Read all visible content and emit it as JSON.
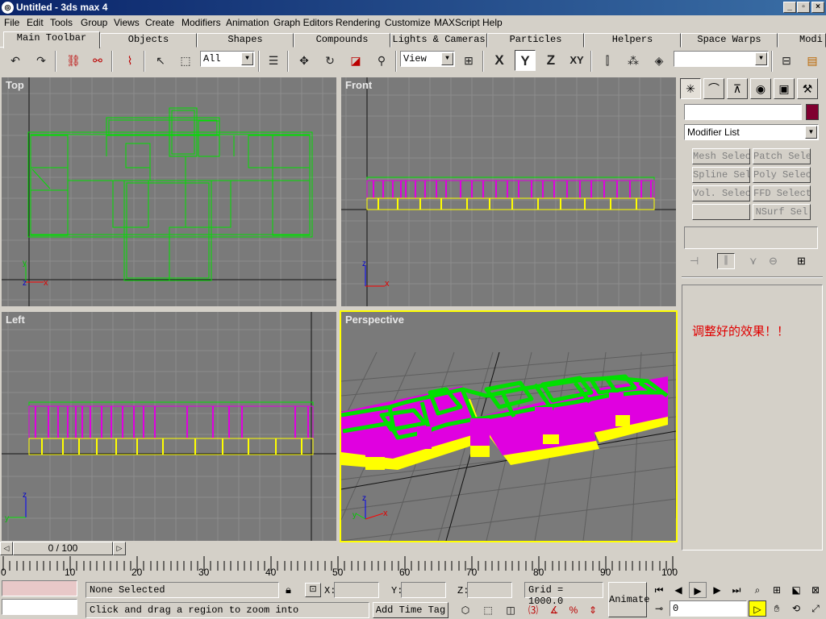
{
  "window": {
    "title": "Untitled - 3ds max 4"
  },
  "menu": [
    "File",
    "Edit",
    "Tools",
    "Group",
    "Views",
    "Create",
    "Modifiers",
    "Animation",
    "Graph Editors",
    "Rendering",
    "Customize",
    "MAXScript",
    "Help"
  ],
  "tabs": [
    "Main Toolbar",
    "Objects",
    "Shapes",
    "Compounds",
    "Lights & Cameras",
    "Particles",
    "Helpers",
    "Space Warps",
    "Modi"
  ],
  "toolbar": {
    "selection_filter": "All",
    "ref_coord": "View",
    "axis_x": "X",
    "axis_y": "Y",
    "axis_z": "Z",
    "axis_xy": "XY",
    "named_selection": ""
  },
  "viewports": {
    "top": "Top",
    "front": "Front",
    "left": "Left",
    "perspective": "Perspective"
  },
  "command_panel": {
    "object_name": "",
    "modifier_list": "Modifier List",
    "modifier_buttons": [
      "Mesh Select",
      "Patch Select",
      "Spline Select",
      "Poly Select",
      "Vol. Select",
      "FFD Select",
      "",
      "NSurf Sel"
    ],
    "note": "调整好的效果！！"
  },
  "timeslider": {
    "label": "0 / 100",
    "ticks": [
      "0",
      "10",
      "20",
      "30",
      "40",
      "50",
      "60",
      "70",
      "80",
      "90",
      "100"
    ]
  },
  "status": {
    "selection": "None Selected",
    "prompt": "Click and drag a region to zoom into",
    "x_label": "X:",
    "y_label": "Y:",
    "z_label": "Z:",
    "grid": "Grid = 1000.0",
    "animate": "Animate",
    "add_time_tag": "Add Time Tag",
    "current_frame": "0"
  },
  "colors": {
    "viewport_bg": "#7a7a7a",
    "grid": "#8a8a8a",
    "wall_green": "#00e000",
    "wall_magenta": "#e000e0",
    "wall_yellow": "#ffff00",
    "active_border": "#ffff00"
  }
}
